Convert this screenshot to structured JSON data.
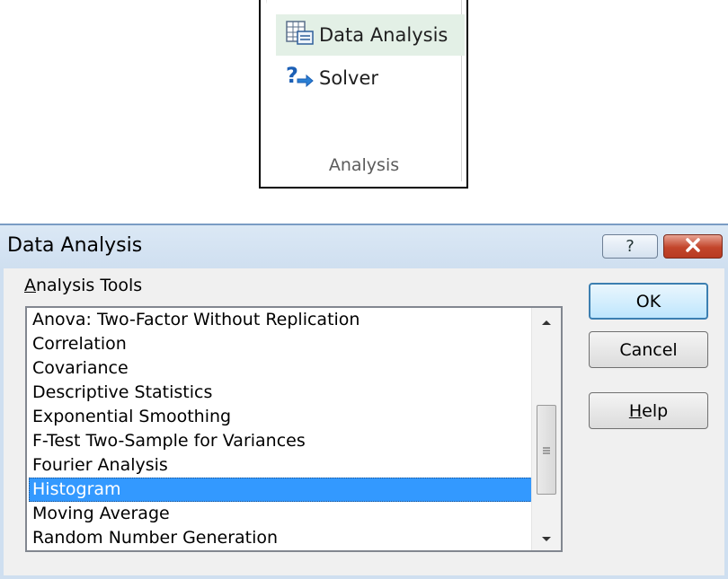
{
  "ribbon": {
    "buttons": [
      {
        "label": "Data Analysis",
        "icon": "data-analysis-icon"
      },
      {
        "label": "Solver",
        "icon": "solver-icon"
      }
    ],
    "group_label": "Analysis"
  },
  "dialog": {
    "title": "Data Analysis",
    "title_buttons": {
      "help": "?",
      "close": "close-icon"
    },
    "tools_label_mnemonic": "A",
    "tools_label_rest": "nalysis Tools",
    "list_items": [
      "Anova: Two-Factor Without Replication",
      "Correlation",
      "Covariance",
      "Descriptive Statistics",
      "Exponential Smoothing",
      "F-Test Two-Sample for Variances",
      "Fourier Analysis",
      "Histogram",
      "Moving Average",
      "Random Number Generation"
    ],
    "selected_item": "Histogram",
    "ok_label": "OK",
    "cancel_label": "Cancel",
    "help_mnemonic": "H",
    "help_rest": "elp"
  },
  "colors": {
    "selection": "#3399ff",
    "ribbon_highlight": "#e3f0e6",
    "close_button": "#c2452b"
  }
}
